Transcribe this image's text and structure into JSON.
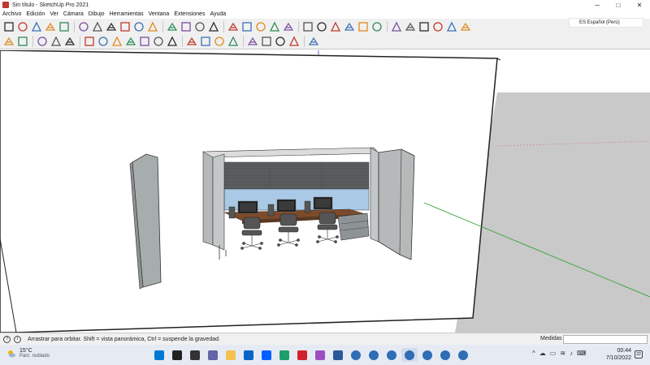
{
  "window": {
    "title": "Sin título - SketchUp Pro 2021",
    "minimize": "─",
    "maximize": "□",
    "close": "✕"
  },
  "menus": [
    "Archivo",
    "Edición",
    "Ver",
    "Cámara",
    "Dibujo",
    "Herramientas",
    "Ventana",
    "Extensiones",
    "Ayuda"
  ],
  "language": "ES Español (Perú)",
  "status": {
    "hint": "Arrastrar para orbitar. Shift = vista panorámica, Ctrl = suspende la gravedad.",
    "measure_label": "Medidas",
    "measure_value": ""
  },
  "weather": {
    "temp": "15°C",
    "desc": "Parc. nublado"
  },
  "clock": {
    "time": "00:44",
    "date": "7/10/2022"
  },
  "notifications": "22",
  "colors": {
    "accent": "#0078d4",
    "axis_green": "#2ea52e",
    "axis_red": "#d08080",
    "panel": "#b8bcbc",
    "ground": "#c9c9c9",
    "sky": "#ffffff"
  },
  "toolbar1_icons": [
    "select-icon",
    "component-icon",
    "paint-icon",
    "eraser-icon",
    "tape-icon",
    "protractor-icon",
    "text-icon",
    "axes-icon",
    "3dtext-icon",
    "section-icon",
    "camera-icon",
    "walk-icon",
    "look-icon",
    "position-camera-icon",
    "hide-icon",
    "shadow-icon",
    "fog-icon",
    "edge-icon",
    "face-icon",
    "xray-icon",
    "back-edges-icon",
    "wireframe-icon",
    "hidden-line-icon",
    "shaded-icon",
    "textured-icon",
    "monochrome-icon",
    "iso-view-icon",
    "top-view-icon",
    "front-view-icon",
    "right-view-icon",
    "back-view-icon",
    "left-view-icon"
  ],
  "toolbar2_icons": [
    "arrow-icon",
    "eraser-icon",
    "pencil-icon",
    "rectangle-icon",
    "pushpull-icon",
    "move-icon",
    "rotate-icon",
    "scale-icon",
    "offset-icon",
    "tape-measure-icon",
    "dimension-icon",
    "paint-bucket-icon",
    "orbit-icon",
    "pan-icon",
    "zoom-icon",
    "zoom-extents-icon",
    "warehouse-icon",
    "extension-icon",
    "layout-icon",
    "sandbox-icon",
    "user-icon"
  ],
  "taskbar_apps": [
    "windows-icon",
    "search-icon",
    "taskview-icon",
    "chat-icon",
    "explorer-icon",
    "mail-icon",
    "dropbox-icon",
    "edge-icon",
    "acrobat-icon",
    "photos-icon",
    "word-icon",
    "sketchup-icon",
    "sketchup-icon",
    "sketchup-icon",
    "sketchup-icon",
    "sketchup-icon",
    "sketchup-icon",
    "sketchup-icon"
  ]
}
